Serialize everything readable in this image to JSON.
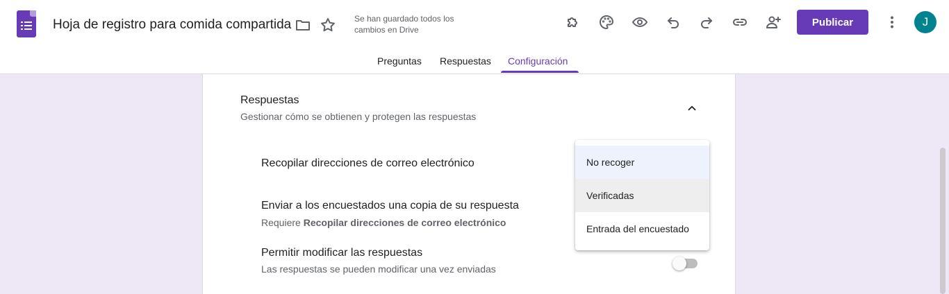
{
  "header": {
    "doc_title": "Hoja de registro para comida compartida",
    "save_status": "Se han guardado todos los cambios en Drive",
    "publish_label": "Publicar",
    "avatar_initial": "J",
    "icons": [
      "forms-logo-icon",
      "folder-icon",
      "star-icon",
      "addon-puzzle-icon",
      "palette-icon",
      "eye-preview-icon",
      "undo-icon",
      "redo-icon",
      "link-icon",
      "add-person-icon",
      "more-vert-icon"
    ]
  },
  "tabs": [
    {
      "label": "Preguntas"
    },
    {
      "label": "Respuestas"
    },
    {
      "label": "Configuración",
      "active": true
    }
  ],
  "section": {
    "title": "Respuestas",
    "subtitle": "Gestionar cómo se obtienen y protegen las respuestas"
  },
  "settings": {
    "collect_emails": {
      "title": "Recopilar direcciones de correo electrónico"
    },
    "send_copy": {
      "title": "Enviar a los encuestados una copia de su respuesta",
      "sub_prefix": "Requiere ",
      "sub_bold": "Recopilar direcciones de correo electrónico"
    },
    "allow_edit": {
      "title": "Permitir modificar las respuestas",
      "subtitle": "Las respuestas se pueden modificar una vez enviadas",
      "enabled": false
    }
  },
  "dropdown": {
    "options": [
      {
        "label": "No recoger",
        "selected": true
      },
      {
        "label": "Verificadas",
        "hovered": true
      },
      {
        "label": "Entrada del encuestado"
      }
    ]
  },
  "colors": {
    "brand": "#673ab7",
    "page_bg": "#ede7f6",
    "avatar": "#00838f"
  }
}
